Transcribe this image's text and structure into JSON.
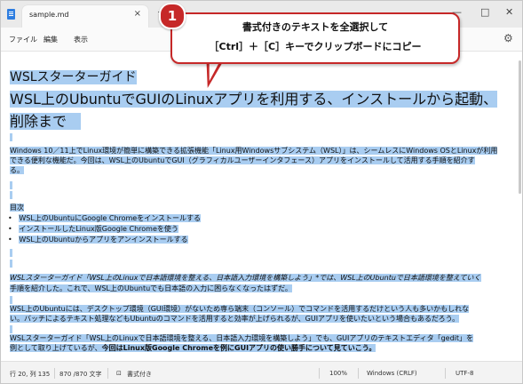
{
  "window": {
    "tab_title": "sample.md",
    "tab_close": "×",
    "new_tab": "+",
    "controls": {
      "minimize": "—",
      "maximize": "□",
      "close": "✕"
    }
  },
  "menu": {
    "file": "ファイル",
    "edit": "編集",
    "view": "表示",
    "settings_icon": "gear-icon"
  },
  "callout": {
    "number": "1",
    "line1": "書式付きのテキストを全選択して",
    "line2": "［Ctrl］＋［C］キーでクリップボードにコピー"
  },
  "document": {
    "h_small": "WSLスターターガイド",
    "h_big_1": "WSL上のUbuntuでGUIのLinuxアプリを利用する、インストールから起動、",
    "h_big_2": "削除まで",
    "p1_1": "Windows 10／11上でLinux環境が簡単に構築できる拡張機能「Linux用Windowsサブシステム（WSL）」は、シームレスにWindows OSとLinuxが利用",
    "p1_2": "できる便利な機能だ。今回は、WSL上のUbuntuでGUI（グラフィカルユーザーインタフェース）アプリをインストールして活用する手順を紹介す",
    "p1_3": "る。",
    "toc_label": "目次",
    "toc": [
      "WSL上のUbuntuにGoogle Chromeをインストールする",
      "インストールしたLinux版Google Chromeを使う",
      "WSL上のUbuntuからアプリをアンインストールする"
    ],
    "p2_1": "WSLスターターガイド「WSL上のLinuxで日本語環境を整える、日本語入力環境を構築しよう」*では、WSL上のUbuntuで日本語環境を整えていく",
    "p2_2": "手順を紹介した。これで、WSL上のUbuntuでも日本語の入力に困らなくなったはずだ。",
    "p3_1": "WSL上のUbuntuには、デスクトップ環境（GUI環境）がないため専ら端末（コンソール）でコマンドを活用するだけという人も多いかもしれな",
    "p3_2": "い。バッチによるテキスト処理などもUbuntuのコマンドを活用すると効率が上げられるが、GUIアプリを使いたいという場合もあるだろう。",
    "p4_1": "WSLスターターガイド「WSL上のLinuxで日本語環境を整える、日本語入力環境を構築しよう」でも、GUIアプリのテキストエディタ「gedit」を",
    "p4_2a": "例として取り上げているが、",
    "p4_2b": "今回はLinux版Google Chromeを例にGUIアプリの使い勝手について見ていこう。"
  },
  "status": {
    "position": "行 20, 列 135",
    "chars": "870 /870 文字",
    "format": "書式付き",
    "zoom": "100%",
    "line_ending": "Windows (CRLF)",
    "encoding": "UTF-8"
  },
  "colors": {
    "selection": "#a9cdf1",
    "callout_red": "#c62828"
  }
}
